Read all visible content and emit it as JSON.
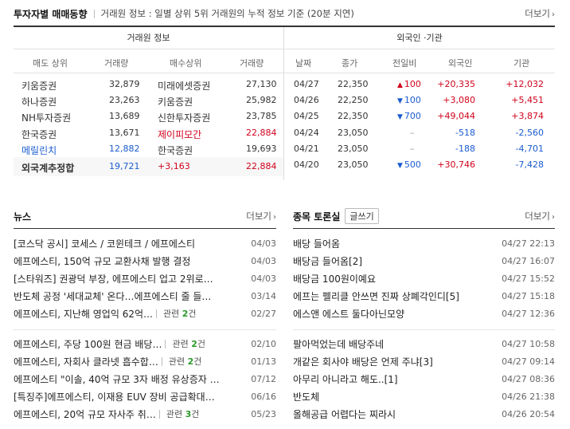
{
  "header": {
    "title": "투자자별 매매동향",
    "desc": "거래원 정보 : 일별 상위 5위 거래원의 누적 정보 기준 (20분 지연)",
    "more": "더보기"
  },
  "broker": {
    "group_label": "거래원 정보",
    "columns": [
      "매도 상위",
      "거래량",
      "매수상위",
      "거래량"
    ],
    "rows": [
      {
        "sell": "키움증권",
        "sell_vol": "32,879",
        "buy": "미래에셋증권",
        "buy_vol": "27,130"
      },
      {
        "sell": "하나증권",
        "sell_vol": "23,263",
        "buy": "키움증권",
        "buy_vol": "25,982"
      },
      {
        "sell": "NH투자증권",
        "sell_vol": "13,689",
        "buy": "신한투자증권",
        "buy_vol": "23,785"
      },
      {
        "sell": "한국증권",
        "sell_vol": "13,671",
        "buy": "제이피모간",
        "buy_vol": "22,884"
      },
      {
        "sell": "메릴린치",
        "sell_vol": "12,882",
        "buy": "한국증권",
        "buy_vol": "19,693"
      }
    ],
    "total": {
      "label": "외국계추정합",
      "sell_vol": "19,721",
      "diff": "+3,163",
      "buy_vol": "22,884"
    }
  },
  "foreign": {
    "group_label": "외국인 ·기관",
    "columns": [
      "날짜",
      "종가",
      "전일비",
      "외국인",
      "기관"
    ],
    "rows": [
      {
        "date": "04/27",
        "close": "22,350",
        "dir": "up",
        "change": "100",
        "foreign": "+20,335",
        "inst": "+12,032"
      },
      {
        "date": "04/26",
        "close": "22,250",
        "dir": "down",
        "change": "100",
        "foreign": "+3,080",
        "inst": "+5,451"
      },
      {
        "date": "04/25",
        "close": "22,350",
        "dir": "down",
        "change": "700",
        "foreign": "+49,044",
        "inst": "+3,874"
      },
      {
        "date": "04/24",
        "close": "23,050",
        "dir": "flat",
        "change": "",
        "foreign": "-518",
        "inst": "-2,560"
      },
      {
        "date": "04/21",
        "close": "23,050",
        "dir": "flat",
        "change": "",
        "foreign": "-188",
        "inst": "-4,701"
      },
      {
        "date": "04/20",
        "close": "23,050",
        "dir": "down",
        "change": "500",
        "foreign": "+30,746",
        "inst": "-7,428"
      }
    ]
  },
  "news": {
    "title": "뉴스",
    "more": "더보기",
    "group1": [
      {
        "title": "[코스닥 공시] 코세스 / 코윈테크 / 에프에스티",
        "related": "",
        "date": "04/03"
      },
      {
        "title": "에프에스티, 150억 규모 교환사채 발행 결정",
        "related": "",
        "date": "04/03"
      },
      {
        "title": "[스타워즈] 권광덕 부장, 에프에스티 업고 2위로…",
        "related": "",
        "date": "04/03"
      },
      {
        "title": "반도체 공정 '세대교체' 온다…에프에스티 줄 들…",
        "related": "",
        "date": "03/14"
      },
      {
        "title": "에프에스티, 지난해 영업익 62억…",
        "related_prefix": "관련 ",
        "related_count": "2",
        "related_suffix": "건",
        "date": "02/27"
      }
    ],
    "group2": [
      {
        "title": "에프에스티, 주당 100원 현금 배당…",
        "related_prefix": "관련 ",
        "related_count": "2",
        "related_suffix": "건",
        "date": "02/10"
      },
      {
        "title": "에프에스티, 자회사 클라넷 흡수합…",
        "related_prefix": "관련 ",
        "related_count": "2",
        "related_suffix": "건",
        "date": "01/13"
      },
      {
        "title": "에프에스티 \"이솔, 40억 규모 3자 배정 유상증자 …",
        "related": "",
        "date": "07/12"
      },
      {
        "title": "[특징주]에프에스티, 이재용 EUV 장비 공급확대…",
        "related": "",
        "date": "06/16"
      },
      {
        "title": "에프에스티, 20억 규모 자사주 취…",
        "related_prefix": "관련 ",
        "related_count": "3",
        "related_suffix": "건",
        "date": "05/23"
      }
    ]
  },
  "board": {
    "title": "종목 토론실",
    "write_label": "글쓰기",
    "more": "더보기",
    "group1": [
      {
        "title": "배당 들어옴",
        "date": "04/27 22:13"
      },
      {
        "title": "배당금 들어옴[2]",
        "date": "04/27 16:07"
      },
      {
        "title": "배당금 100원이예요",
        "date": "04/27 15:52"
      },
      {
        "title": "에프는 펠리클 안쓰면 진짜 상폐각인디[5]",
        "date": "04/27 15:18"
      },
      {
        "title": "에스앤 에스트 둘다아닌모양",
        "date": "04/27 12:36"
      }
    ],
    "group2": [
      {
        "title": "팔아먹었는데 배당주네",
        "date": "04/27 10:58"
      },
      {
        "title": "개같은 회사야 배당은 언제 주냐[3]",
        "date": "04/27 09:14"
      },
      {
        "title": "아무리 아니라고 해도..[1]",
        "date": "04/27 08:36"
      },
      {
        "title": "반도체",
        "date": "04/26 21:38"
      },
      {
        "title": "올해공급 어렵다는 찌라시",
        "date": "04/26 20:54"
      }
    ]
  },
  "colors": {
    "up": "#d0021b",
    "down": "#1a5cd0",
    "related_count": "#2c9a2c"
  }
}
